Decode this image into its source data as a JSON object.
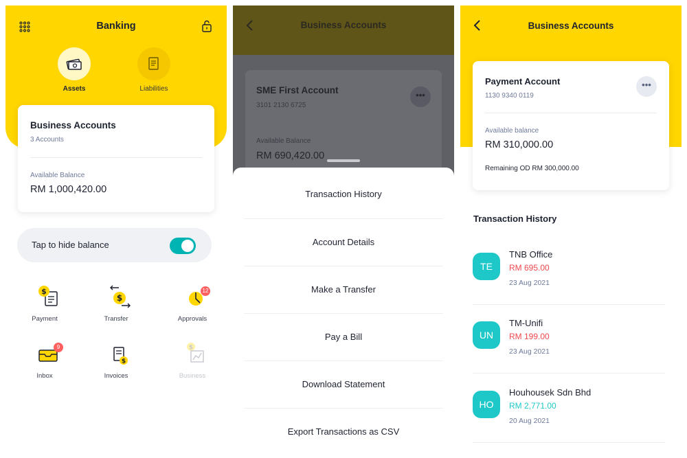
{
  "screen1": {
    "title": "Banking",
    "tabs": [
      {
        "label": "Assets",
        "icon": "money-icon"
      },
      {
        "label": "Liabilities",
        "icon": "document-icon"
      }
    ],
    "card": {
      "title": "Business Accounts",
      "subtitle": "3 Accounts",
      "balance_label": "Available Balance",
      "balance_value": "RM 1,000,420.00"
    },
    "hide_balance": {
      "label": "Tap to hide balance",
      "on": true
    },
    "menu": [
      {
        "label": "Payment",
        "icon": "payment-icon"
      },
      {
        "label": "Transfer",
        "icon": "transfer-icon"
      },
      {
        "label": "Approvals",
        "icon": "approvals-icon",
        "badge": "12"
      },
      {
        "label": "Inbox",
        "icon": "inbox-icon",
        "badge": "9"
      },
      {
        "label": "Invoices",
        "icon": "invoices-icon"
      },
      {
        "label": "Business",
        "icon": "business-icon"
      }
    ]
  },
  "screen2": {
    "title": "Business Accounts",
    "card": {
      "title": "SME First Account",
      "number": "3101 2130 6725",
      "balance_label": "Available Balance",
      "balance_value": "RM 690,420.00",
      "more": "•••"
    },
    "sheet_items": [
      "Transaction History",
      "Account Details",
      "Make a Transfer",
      "Pay a Bill",
      "Download Statement",
      "Export Transactions as CSV"
    ]
  },
  "screen3": {
    "title": "Business Accounts",
    "card": {
      "title": "Payment Account",
      "number": "1130 9340 0119",
      "balance_label": "Available balance",
      "balance_value": "RM 310,000.00",
      "remaining_od": "Remaining OD RM 300,000.00",
      "more": "•••"
    },
    "section_title": "Transaction History",
    "transactions": [
      {
        "initials": "TE",
        "name": "TNB Office",
        "amount": "RM 695.00",
        "date": "23 Aug 2021",
        "color": "#f0474c"
      },
      {
        "initials": "UN",
        "name": "TM-Unifi",
        "amount": "RM 199.00",
        "date": "23 Aug 2021",
        "color": "#f0474c"
      },
      {
        "initials": "HO",
        "name": "Houhousek Sdn Bhd",
        "amount": "RM 2,771.00",
        "date": "20 Aug 2021",
        "color": "#1ec8c8"
      }
    ]
  },
  "colors": {
    "brand_yellow": "#ffd600",
    "accent_teal": "#00b4b4",
    "debit_red": "#f0474c"
  }
}
